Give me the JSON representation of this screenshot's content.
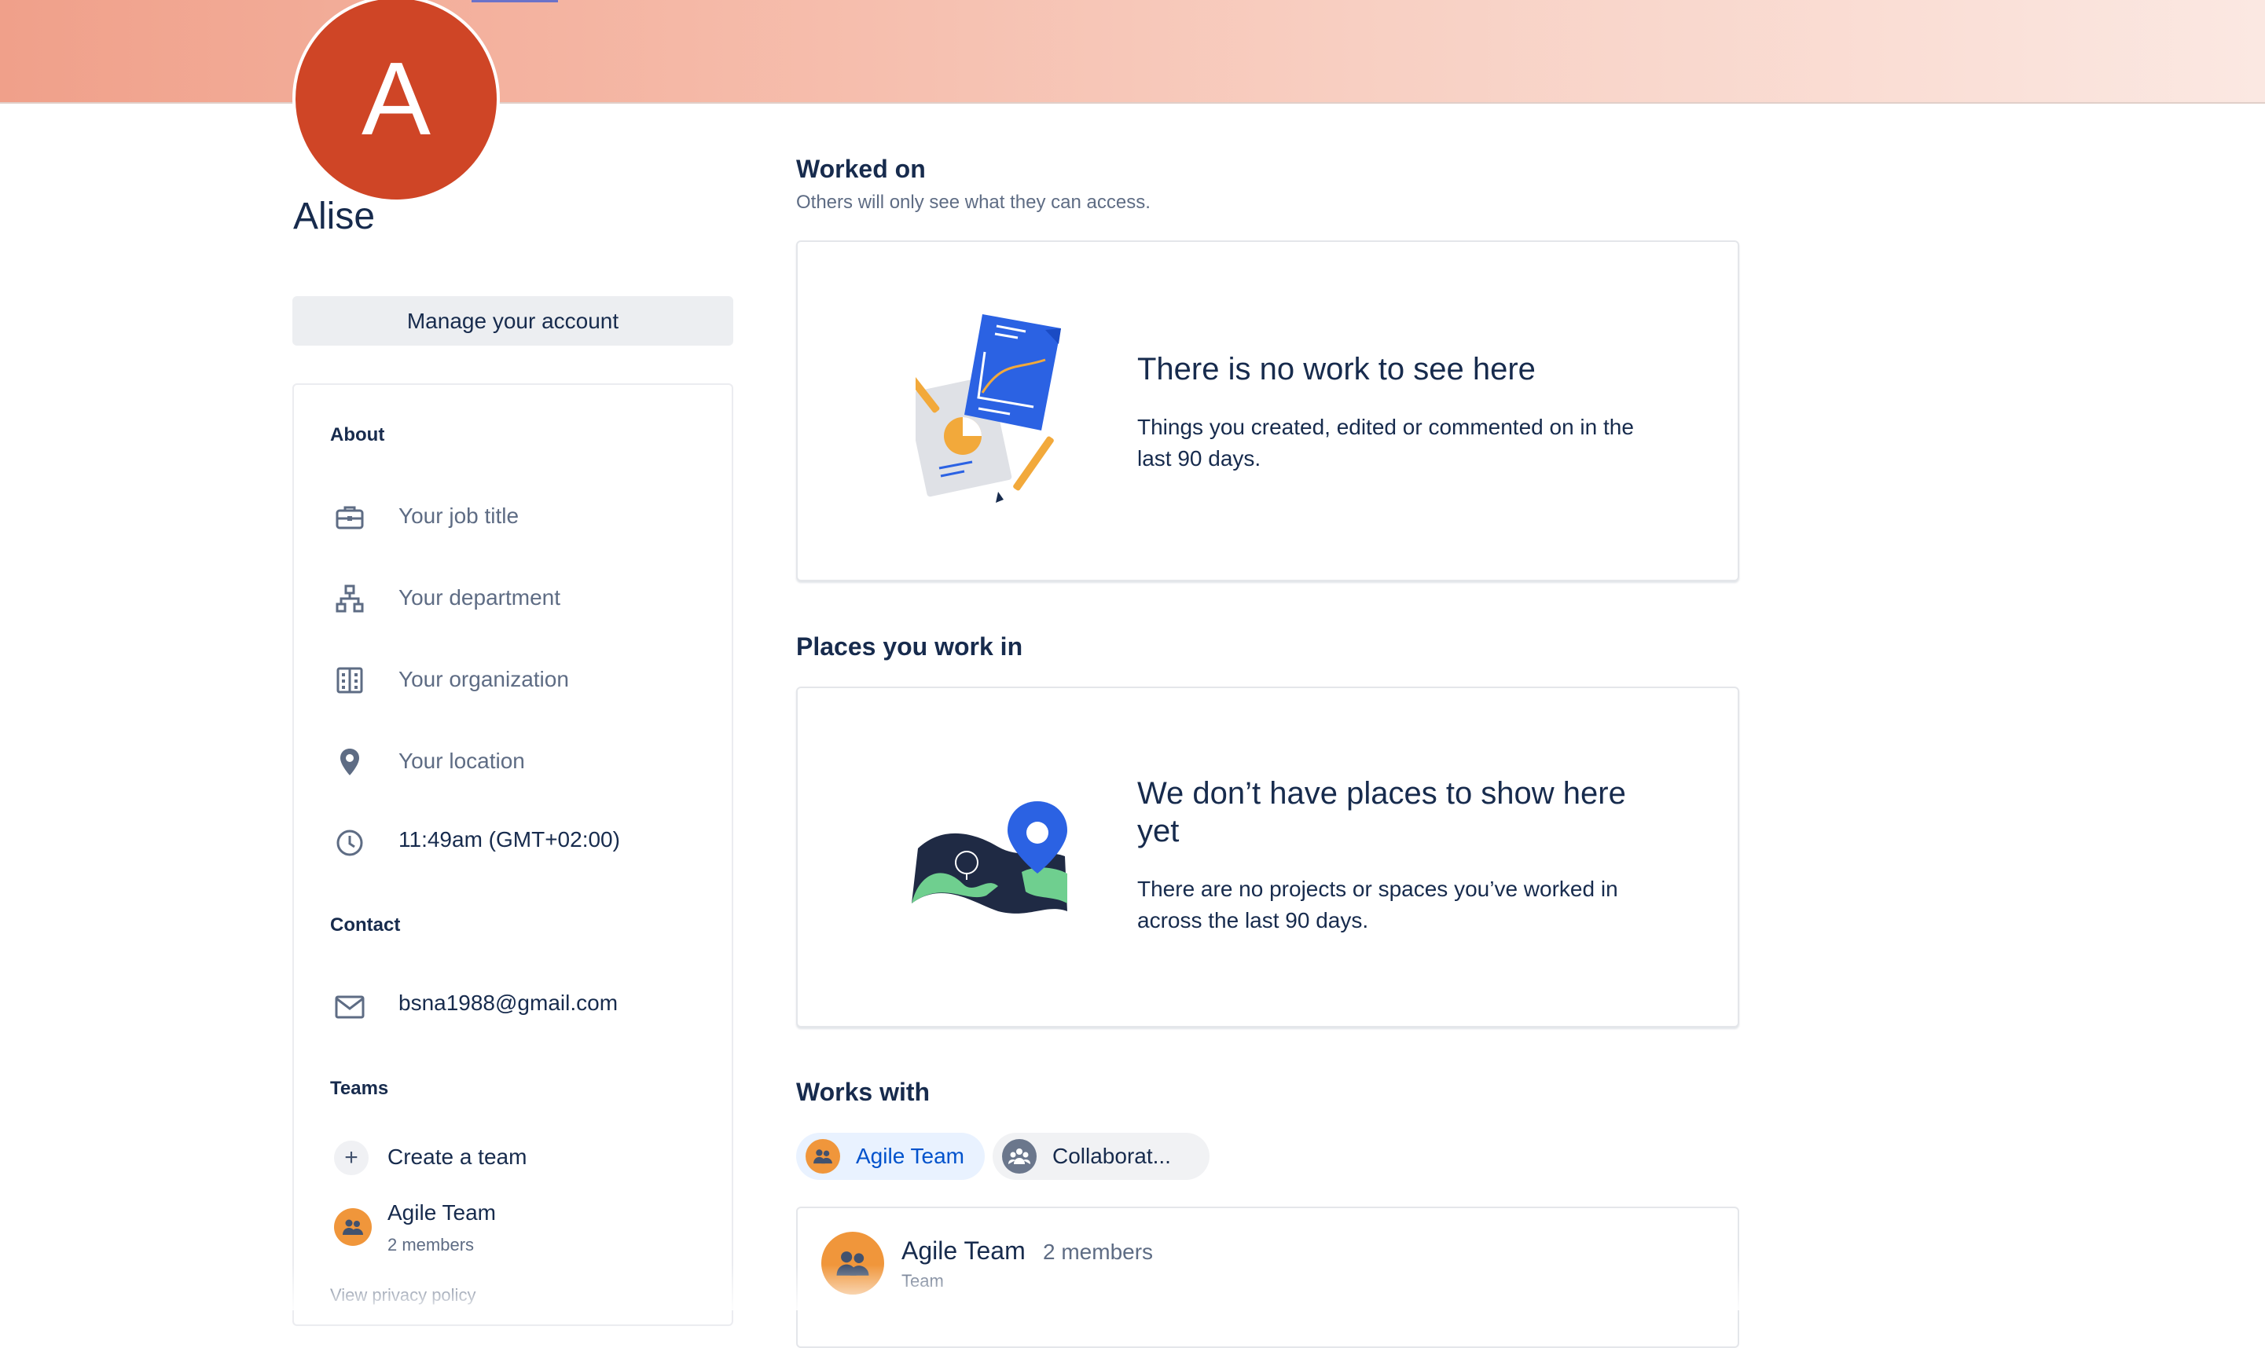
{
  "profile": {
    "avatar_letter": "A",
    "name": "Alise",
    "manage_label": "Manage your account"
  },
  "about": {
    "heading": "About",
    "job_title_placeholder": "Your job title",
    "department_placeholder": "Your department",
    "organization_placeholder": "Your organization",
    "location_placeholder": "Your location",
    "local_time": "11:49am (GMT+02:00)"
  },
  "contact": {
    "heading": "Contact",
    "email": "bsna1988@gmail.com"
  },
  "teams": {
    "heading": "Teams",
    "create_label": "Create a team",
    "items": [
      {
        "name": "Agile Team",
        "members": "2 members"
      }
    ]
  },
  "privacy_label": "View privacy policy",
  "worked_on": {
    "heading": "Worked on",
    "subtitle": "Others will only see what they can access.",
    "empty_title": "There is no work to see here",
    "empty_body": "Things you created, edited or commented on in the last 90 days."
  },
  "places": {
    "heading": "Places you work in",
    "empty_title": "We don’t have places to show here yet",
    "empty_body": "There are no projects or spaces you’ve worked in across the last 90 days."
  },
  "works_with": {
    "heading": "Works with",
    "pills": [
      {
        "label": "Agile Team",
        "selected": true
      },
      {
        "label": "Collaborat...",
        "selected": false
      }
    ],
    "team_card": {
      "name": "Agile Team",
      "members": "2 members",
      "type": "Team"
    }
  },
  "colors": {
    "avatar": "#cf4526",
    "team_orange": "#f0963b",
    "link_blue": "#0052cc",
    "pill_selected_bg": "#e9f2ff"
  }
}
